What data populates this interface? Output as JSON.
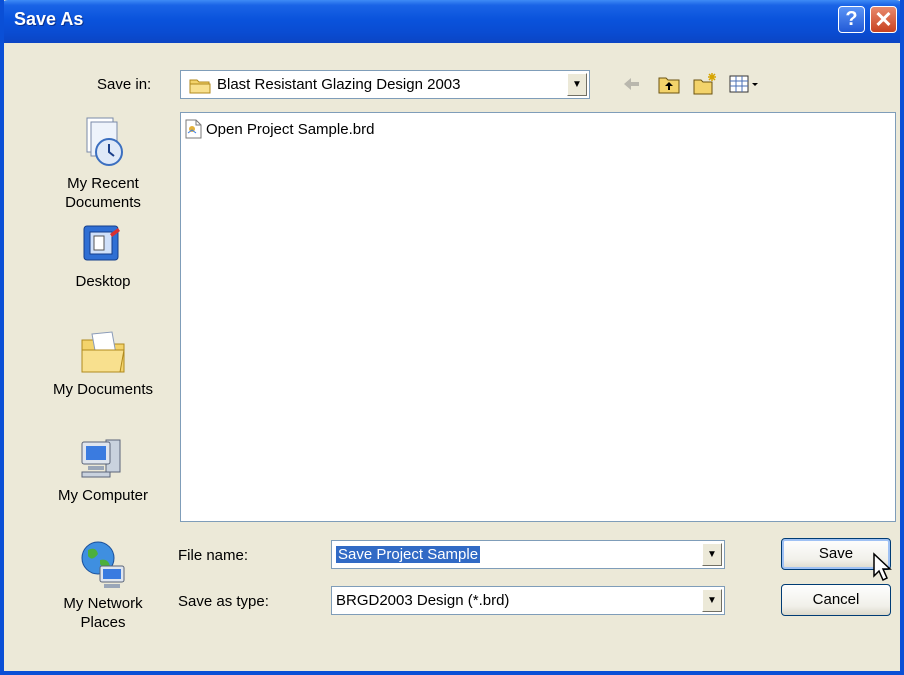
{
  "window": {
    "title": "Save As"
  },
  "titlebar": {
    "help_label": "?",
    "close_label": "✕"
  },
  "savein": {
    "label": "Save in:",
    "value": "Blast Resistant Glazing Design 2003"
  },
  "toolbar": {
    "back_icon": "back-arrow-icon",
    "up_icon": "up-folder-icon",
    "new_folder_icon": "new-folder-icon",
    "view_icon": "view-menu-icon"
  },
  "places": [
    {
      "label_line1": "My Recent",
      "label_line2": "Documents",
      "icon": "recent-documents-icon"
    },
    {
      "label_line1": "Desktop",
      "label_line2": "",
      "icon": "desktop-icon"
    },
    {
      "label_line1": "My Documents",
      "label_line2": "",
      "icon": "my-documents-icon"
    },
    {
      "label_line1": "My Computer",
      "label_line2": "",
      "icon": "my-computer-icon"
    },
    {
      "label_line1": "My Network",
      "label_line2": "Places",
      "icon": "network-places-icon"
    }
  ],
  "files": [
    {
      "name": "Open Project Sample.brd",
      "icon": "brd-file-icon"
    }
  ],
  "filename": {
    "label": "File name:",
    "value": "Save Project Sample"
  },
  "filetype": {
    "label": "Save as type:",
    "value": "BRGD2003 Design (*.brd)"
  },
  "buttons": {
    "save": "Save",
    "cancel": "Cancel"
  },
  "colors": {
    "title_blue": "#0a4cd2",
    "dialog_bg": "#ece9d8",
    "selection": "#316ac5"
  }
}
